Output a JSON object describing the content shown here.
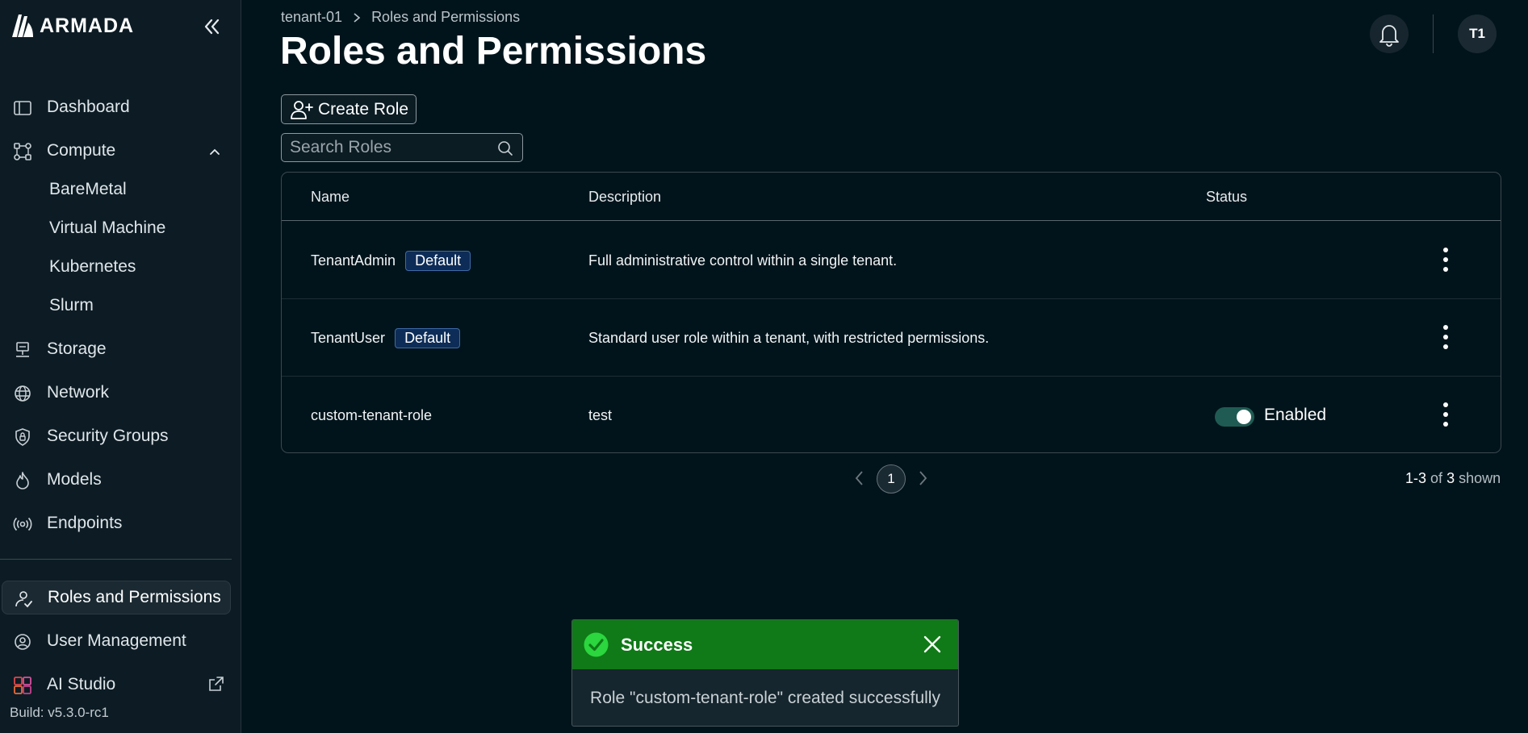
{
  "brand": {
    "name": "ARMADA"
  },
  "sidebar": {
    "items": [
      {
        "label": "Dashboard"
      },
      {
        "label": "Compute"
      },
      {
        "label": "BareMetal"
      },
      {
        "label": "Virtual Machine"
      },
      {
        "label": "Kubernetes"
      },
      {
        "label": "Slurm"
      },
      {
        "label": "Storage"
      },
      {
        "label": "Network"
      },
      {
        "label": "Security Groups"
      },
      {
        "label": "Models"
      },
      {
        "label": "Endpoints"
      },
      {
        "label": "Roles and Permissions",
        "active": true
      },
      {
        "label": "User Management"
      },
      {
        "label": "AI Studio"
      }
    ],
    "build": "Build: v5.3.0-rc1"
  },
  "header": {
    "breadcrumb": [
      "tenant-01",
      "Roles and Permissions"
    ],
    "title": "Roles and Permissions",
    "avatar_initials": "T1"
  },
  "toolbar": {
    "create_label": "Create Role",
    "search_placeholder": "Search Roles",
    "search_value": ""
  },
  "table": {
    "columns": [
      "Name",
      "Description",
      "Status"
    ],
    "rows": [
      {
        "name": "TenantAdmin",
        "badge": "Default",
        "description": "Full administrative control within a single tenant.",
        "status": ""
      },
      {
        "name": "TenantUser",
        "badge": "Default",
        "description": "Standard user role within a tenant, with restricted permissions.",
        "status": ""
      },
      {
        "name": "custom-tenant-role",
        "badge": "",
        "description": "test",
        "status": "Enabled"
      }
    ]
  },
  "pagination": {
    "current_page": "1",
    "range": "1-3",
    "of_word": "of",
    "total": "3",
    "shown_word": "shown"
  },
  "toast": {
    "title": "Success",
    "message": "Role \"custom-tenant-role\" created successfully"
  },
  "colors": {
    "background": "#02141b",
    "sidebar": "#0d1c24",
    "toast_header": "#0f7a17",
    "badge": "#0d2c57",
    "toggle_on": "#1f5b53"
  }
}
